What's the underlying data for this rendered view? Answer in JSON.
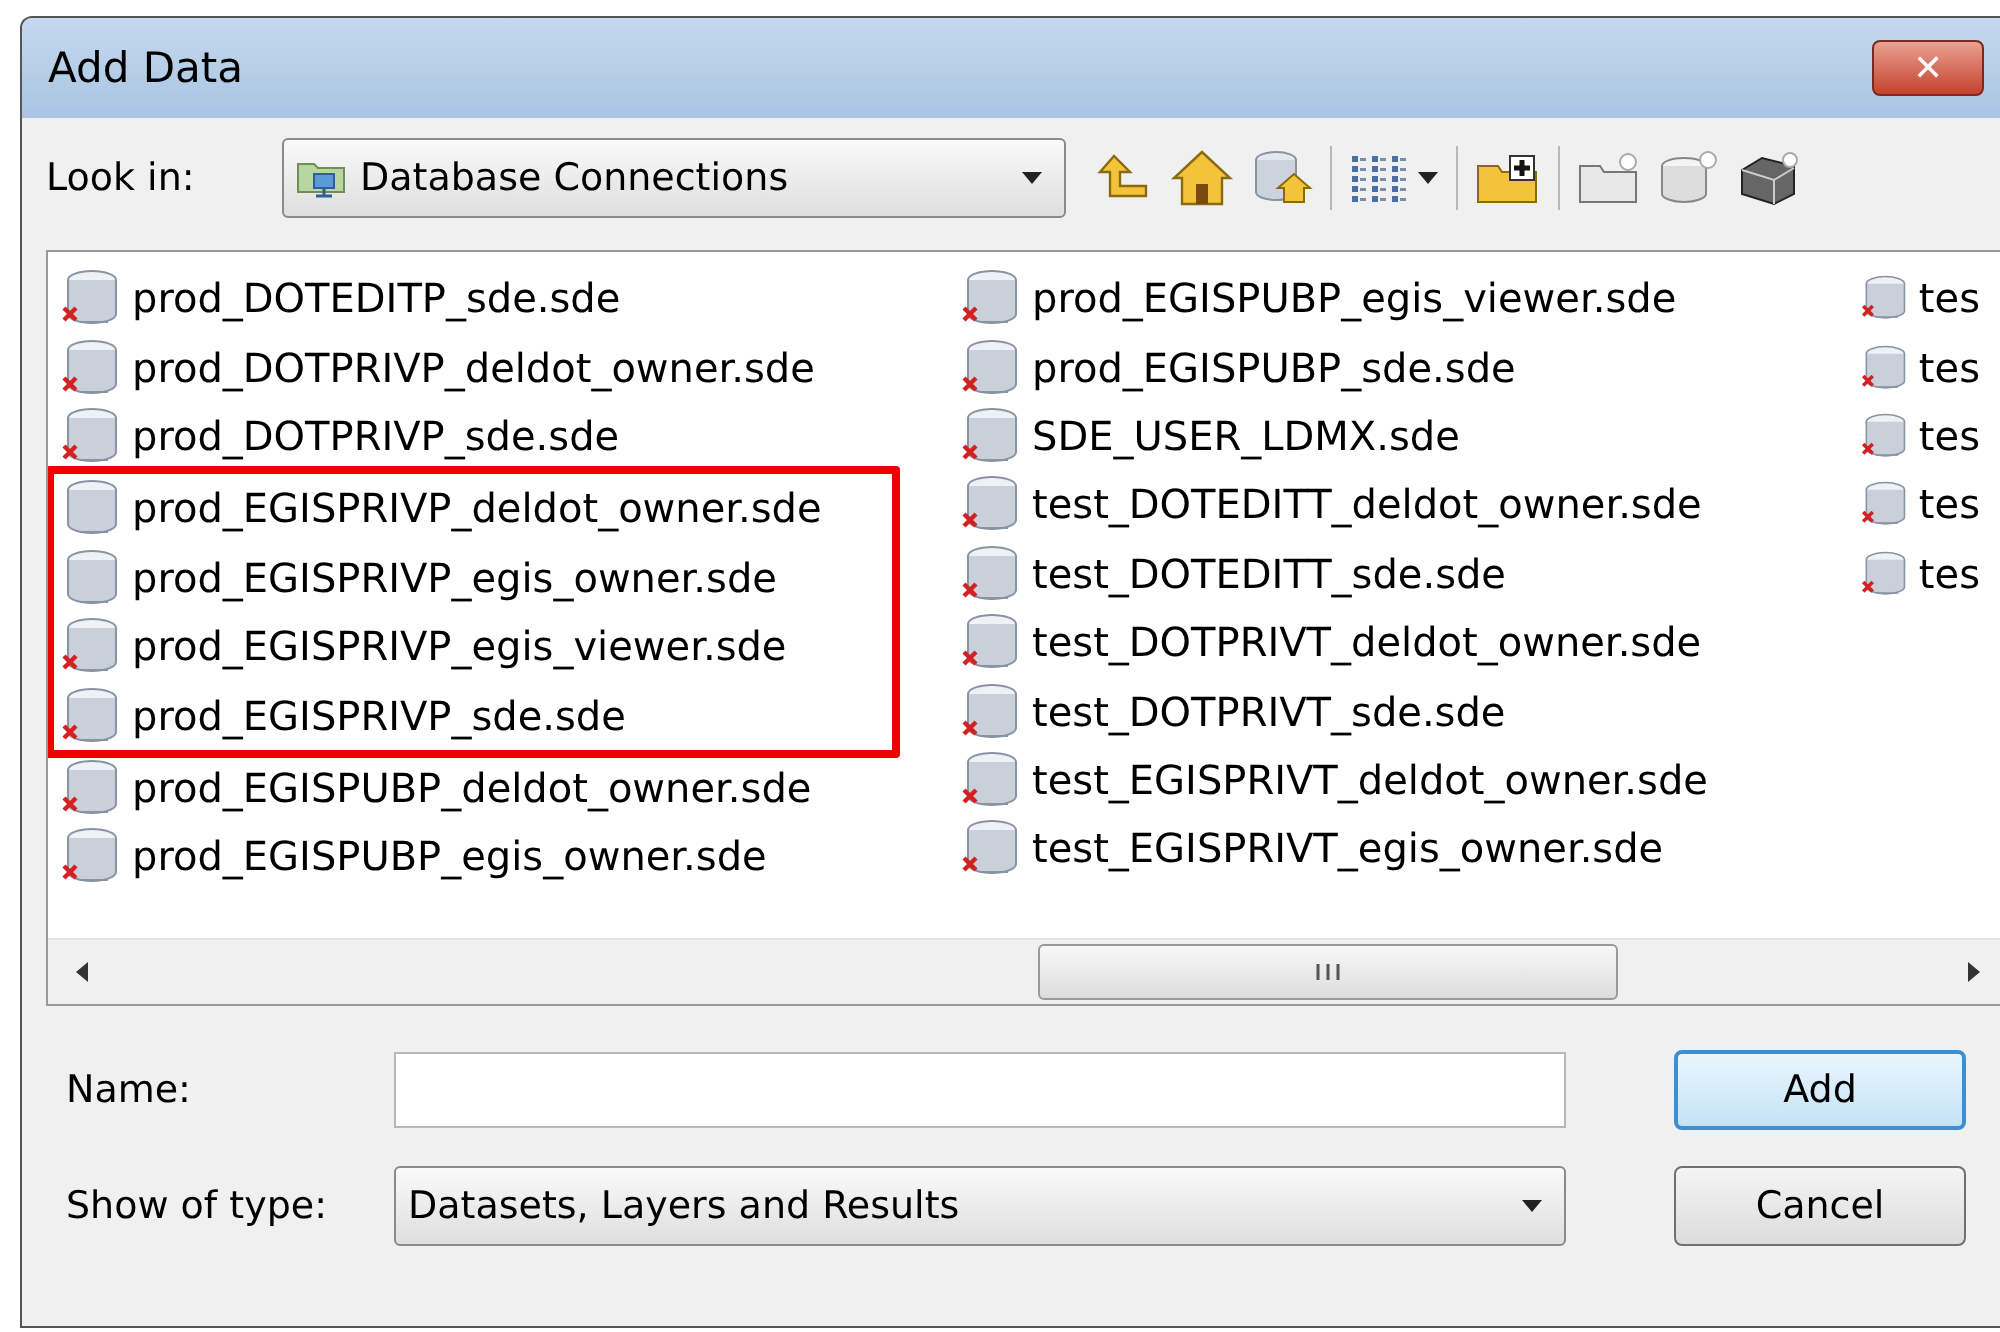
{
  "window": {
    "title": "Add Data",
    "close": "✕"
  },
  "look_in": {
    "label": "Look in:",
    "value": "Database Connections"
  },
  "file_list": {
    "columns": [
      [
        {
          "name": "prod_DOTEDITP_sde.sde",
          "broken": true,
          "highlighted": false
        },
        {
          "name": "prod_DOTPRIVP_deldot_owner.sde",
          "broken": true,
          "highlighted": false
        },
        {
          "name": "prod_DOTPRIVP_sde.sde",
          "broken": true,
          "highlighted": false
        },
        {
          "name": "prod_EGISPRIVP_deldot_owner.sde",
          "broken": false,
          "highlighted": true
        },
        {
          "name": "prod_EGISPRIVP_egis_owner.sde",
          "broken": false,
          "highlighted": true
        },
        {
          "name": "prod_EGISPRIVP_egis_viewer.sde",
          "broken": true,
          "highlighted": true
        },
        {
          "name": "prod_EGISPRIVP_sde.sde",
          "broken": true,
          "highlighted": true
        },
        {
          "name": "prod_EGISPUBP_deldot_owner.sde",
          "broken": true,
          "highlighted": false
        },
        {
          "name": "prod_EGISPUBP_egis_owner.sde",
          "broken": true,
          "highlighted": false
        }
      ],
      [
        {
          "name": "prod_EGISPUBP_egis_viewer.sde",
          "broken": true,
          "highlighted": false
        },
        {
          "name": "prod_EGISPUBP_sde.sde",
          "broken": true,
          "highlighted": false
        },
        {
          "name": "SDE_USER_LDMX.sde",
          "broken": true,
          "highlighted": false
        },
        {
          "name": "test_DOTEDITT_deldot_owner.sde",
          "broken": true,
          "highlighted": false
        },
        {
          "name": "test_DOTEDITT_sde.sde",
          "broken": true,
          "highlighted": false
        },
        {
          "name": "test_DOTPRIVT_deldot_owner.sde",
          "broken": true,
          "highlighted": false
        },
        {
          "name": "test_DOTPRIVT_sde.sde",
          "broken": true,
          "highlighted": false
        },
        {
          "name": "test_EGISPRIVT_deldot_owner.sde",
          "broken": true,
          "highlighted": false
        },
        {
          "name": "test_EGISPRIVT_egis_owner.sde",
          "broken": true,
          "highlighted": false
        }
      ],
      [
        {
          "name": "tes",
          "broken": true,
          "highlighted": false
        },
        {
          "name": "tes",
          "broken": true,
          "highlighted": false
        },
        {
          "name": "tes",
          "broken": true,
          "highlighted": false
        },
        {
          "name": "tes",
          "broken": true,
          "highlighted": false
        },
        {
          "name": "tes",
          "broken": true,
          "highlighted": false
        }
      ]
    ]
  },
  "name_field": {
    "label": "Name:"
  },
  "type_field": {
    "label": "Show of type:",
    "value": "Datasets, Layers and Results"
  },
  "buttons": [
    {
      "label": "Add",
      "default": true
    },
    {
      "label": "Cancel",
      "default": false
    }
  ]
}
